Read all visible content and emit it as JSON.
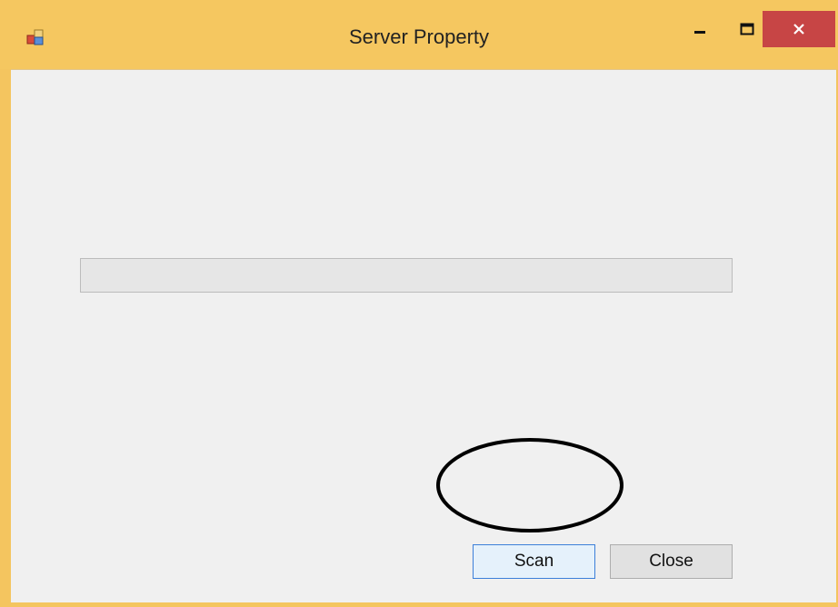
{
  "window": {
    "title": "Server Property",
    "controls": {
      "minimize_icon": "minimize-icon",
      "maximize_icon": "maximize-icon",
      "close_icon": "close-icon"
    }
  },
  "progress": {
    "value_percent": 0
  },
  "buttons": {
    "scan_label": "Scan",
    "close_label": "Close"
  },
  "colors": {
    "titlebar": "#f5c760",
    "close_control": "#c74545",
    "client_bg": "#f0f0f0",
    "focus_border": "#3c7fd9"
  }
}
